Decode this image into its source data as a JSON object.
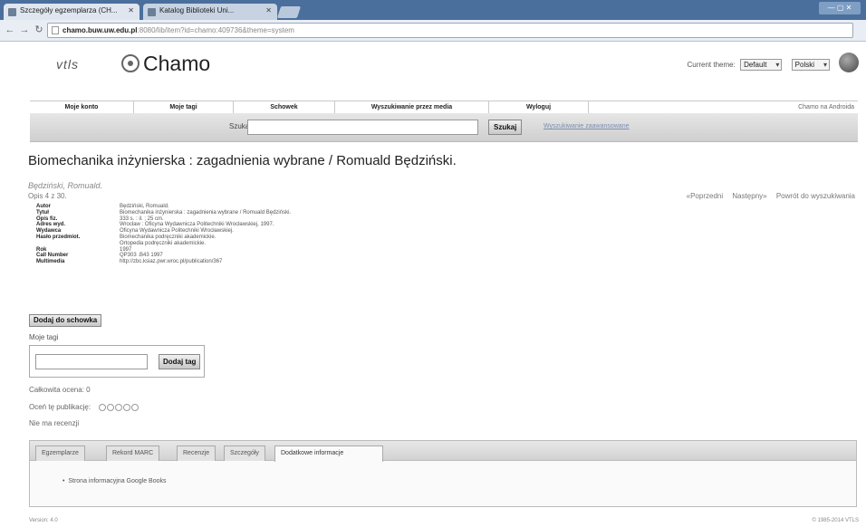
{
  "browser": {
    "tabs": [
      {
        "title": "Szczegóły egzemplarza (CH..."
      },
      {
        "title": "Katalog Biblioteki Uni..."
      }
    ],
    "url_host": "chamo.buw.uw.edu.pl",
    "url_rest": ":8080/lib/item?id=chamo:409736&theme=system"
  },
  "header": {
    "logo_vtls": "vtls",
    "logo_name": "Chamo",
    "theme_label": "Current theme:",
    "theme_value": "Default",
    "language_value": "Polski"
  },
  "menu": {
    "items": [
      "Moje konto",
      "Moje tagi",
      "Schowek",
      "Wyszukiwanie przez media",
      "Wyloguj"
    ],
    "right": "Chamo na Androida"
  },
  "search": {
    "label": "Szukaj",
    "value": "",
    "button": "Szukaj",
    "advanced": "Wyszukiwanie zaawansowane"
  },
  "record": {
    "title": "Biomechanika inżynierska : zagadnienia wybrane / Romuald Będziński.",
    "author": "Będziński, Romuald.",
    "count": "Opis 4 z 30.",
    "nav": [
      "«Poprzedni",
      "Następny»",
      "Powrót do wyszukiwania"
    ],
    "fields": [
      {
        "k": "Autor",
        "v": "Będziński, Romuald."
      },
      {
        "k": "Tytuł",
        "v": "Biomechanika inżynierska : zagadnienia wybrane / Romuald Będziński."
      },
      {
        "k": "Opis fiz.",
        "v": "333 s. : il. ; 25 cm."
      },
      {
        "k": "Adres wyd.",
        "v": "Wrocław : Oficyna Wydawnicza Politechniki Wrocławskiej, 1997."
      },
      {
        "k": "Wydawca",
        "v": "Oficyna Wydawnicza Politechniki Wrocławskiej."
      },
      {
        "k": "Hasło przedmiot.",
        "v": "Biomechanika podręczniki akademickie."
      },
      {
        "k": "",
        "v": "Ortopedia podręczniki akademickie."
      },
      {
        "k": "Rok",
        "v": "1997"
      },
      {
        "k": "Call Number",
        "v": "QP303 .B43 1997"
      },
      {
        "k": "Multimedia",
        "v": "http://zbc.ksiaz.pwr.wroc.pl/publication/367"
      }
    ],
    "basket_button": "Dodaj do schowka",
    "my_tags": "Moje tagi",
    "add_tag_button": "Dodaj tag",
    "total_rating": "Całkowita ocena: 0",
    "rate_label": "Oceń tę publikację:",
    "no_reviews": "Nie ma recenzji"
  },
  "panel": {
    "tabs": [
      "Egzemplarze",
      "Rekord MARC",
      "Recenzje",
      "Szczegóły",
      "Dodatkowe informacje"
    ],
    "active": 4,
    "bullet": "Strona informacyjna Google Books"
  },
  "footer": {
    "left": "Version: 4.0",
    "right": "© 1985-2014 VTLS"
  }
}
